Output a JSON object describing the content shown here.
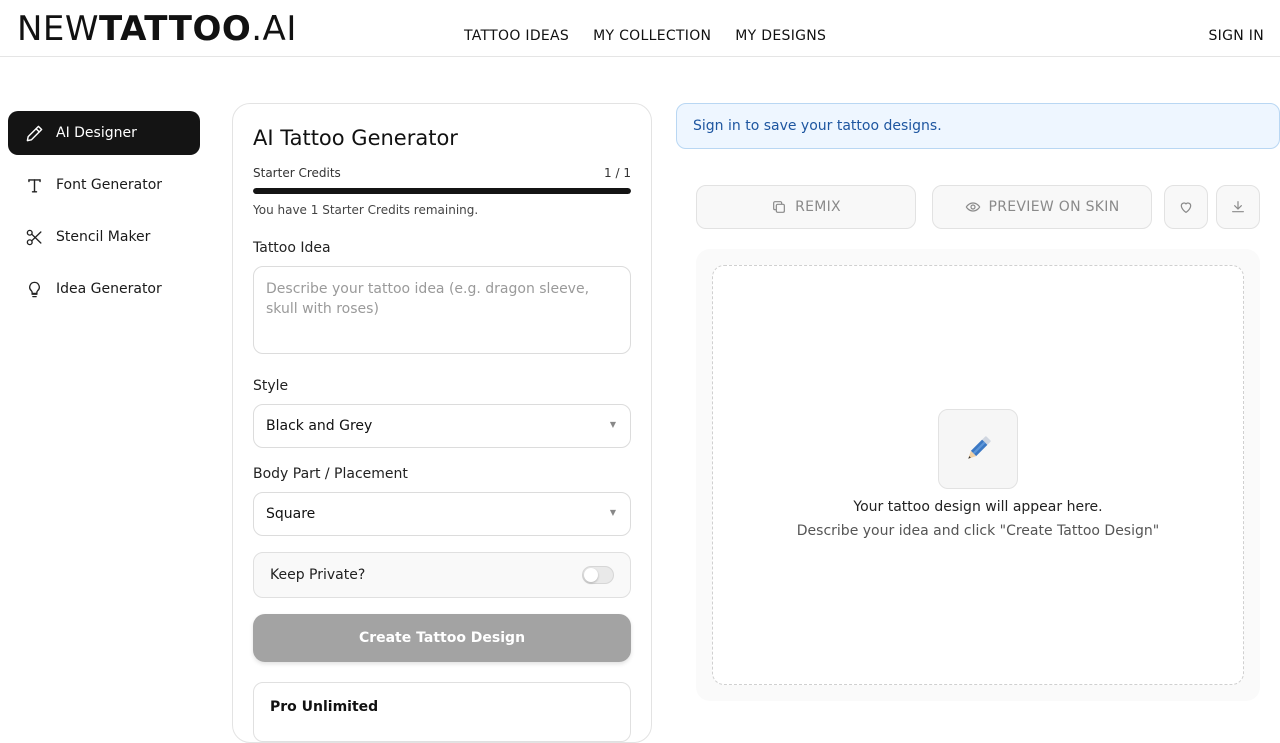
{
  "header": {
    "logo": {
      "part1": "NEW",
      "part2": "TATTOO",
      "part3": ".AI"
    },
    "nav": [
      "TATTOO IDEAS",
      "MY COLLECTION",
      "MY DESIGNS"
    ],
    "sign_in": "SIGN IN"
  },
  "sidebar": {
    "items": [
      {
        "label": "AI Designer",
        "icon": "pencil-icon",
        "active": true
      },
      {
        "label": "Font Generator",
        "icon": "text-icon",
        "active": false
      },
      {
        "label": "Stencil Maker",
        "icon": "scissors-icon",
        "active": false
      },
      {
        "label": "Idea Generator",
        "icon": "lightbulb-icon",
        "active": false
      }
    ]
  },
  "generator": {
    "title": "AI Tattoo Generator",
    "credits_label": "Starter Credits",
    "credits_count": "1 / 1",
    "credits_fraction": 1.0,
    "credits_note": "You have 1 Starter Credits remaining.",
    "idea_label": "Tattoo Idea",
    "idea_value": "",
    "idea_placeholder": "Describe your tattoo idea (e.g. dragon sleeve, skull with roses)",
    "style_label": "Style",
    "style_value": "Black and Grey",
    "placement_label": "Body Part / Placement",
    "placement_value": "Square",
    "private_label": "Keep Private?",
    "private_on": false,
    "create_label": "Create Tattoo Design",
    "pro_label": "Pro Unlimited"
  },
  "preview": {
    "banner": "Sign in to save your tattoo designs.",
    "remix_label": "REMIX",
    "preview_label": "PREVIEW ON SKIN",
    "empty_title": "Your tattoo design will appear here.",
    "empty_hint": "Describe your idea and click \"Create Tattoo Design\""
  },
  "colors": {
    "active_bg": "#141414",
    "banner_bg": "#eef6ff",
    "banner_text": "#1e56a0",
    "disabled_btn": "#a3a3a3"
  }
}
